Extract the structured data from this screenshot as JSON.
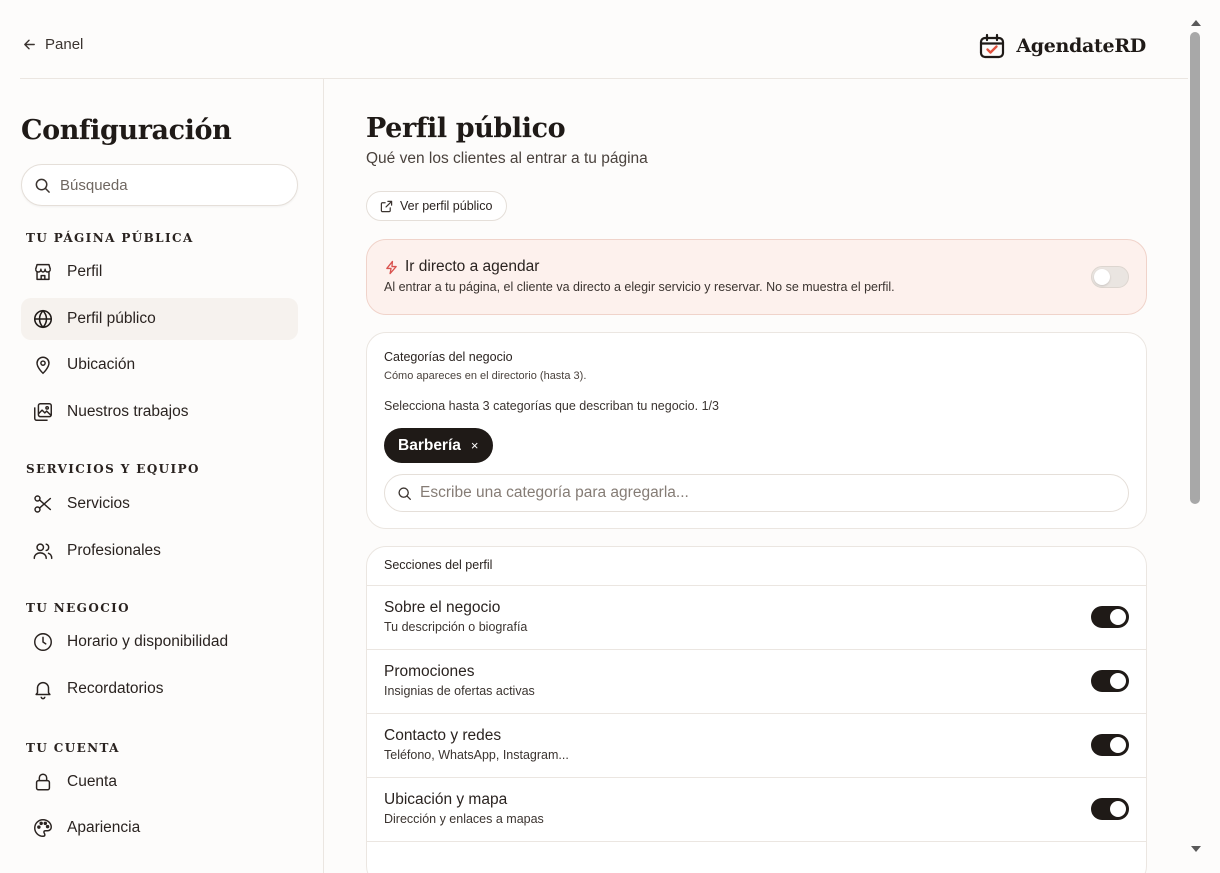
{
  "topbar": {
    "back_label": "Panel",
    "brand": "AgendateRD"
  },
  "sidebar": {
    "title": "Configuración",
    "search_placeholder": "Búsqueda",
    "groups": [
      {
        "label": "Tu página pública",
        "items": [
          {
            "label": "Perfil",
            "icon": "storefront-icon"
          },
          {
            "label": "Perfil público",
            "icon": "globe-icon",
            "active": true
          },
          {
            "label": "Ubicación",
            "icon": "map-pin-icon"
          },
          {
            "label": "Nuestros trabajos",
            "icon": "gallery-icon"
          }
        ]
      },
      {
        "label": "Servicios y equipo",
        "items": [
          {
            "label": "Servicios",
            "icon": "scissors-icon"
          },
          {
            "label": "Profesionales",
            "icon": "users-icon"
          }
        ]
      },
      {
        "label": "Tu negocio",
        "items": [
          {
            "label": "Horario y disponibilidad",
            "icon": "clock-icon"
          },
          {
            "label": "Recordatorios",
            "icon": "bell-icon"
          }
        ]
      },
      {
        "label": "Tu cuenta",
        "items": [
          {
            "label": "Cuenta",
            "icon": "lock-icon"
          },
          {
            "label": "Apariencia",
            "icon": "palette-icon"
          }
        ]
      }
    ]
  },
  "main": {
    "title": "Perfil público",
    "subtitle": "Qué ven los clientes al entrar a tu página",
    "view_button": "Ver perfil público",
    "direct": {
      "title": "Ir directo a agendar",
      "description": "Al entrar a tu página, el cliente va directo a elegir servicio y reservar. No se muestra el perfil.",
      "enabled": false
    },
    "categories": {
      "title": "Categorías del negocio",
      "subtitle": "Cómo apareces en el directorio (hasta 3).",
      "hint": "Selecciona hasta 3 categorías que describan tu negocio. 1/3",
      "selected": [
        "Barbería"
      ],
      "remove_symbol": "×",
      "search_placeholder": "Escribe una categoría para agregarla..."
    },
    "sections": {
      "title": "Secciones del perfil",
      "rows": [
        {
          "title": "Sobre el negocio",
          "description": "Tu descripción o biografía",
          "enabled": true
        },
        {
          "title": "Promociones",
          "description": "Insignias de ofertas activas",
          "enabled": true
        },
        {
          "title": "Contacto y redes",
          "description": "Teléfono, WhatsApp, Instagram...",
          "enabled": true
        },
        {
          "title": "Ubicación y mapa",
          "description": "Dirección y enlaces a mapas",
          "enabled": true
        }
      ]
    }
  },
  "colors": {
    "accent_dark": "#1f1a17",
    "direct_card_bg": "#fdf1ed",
    "bolt_icon": "#d9534f",
    "border": "#ebe6e1"
  }
}
